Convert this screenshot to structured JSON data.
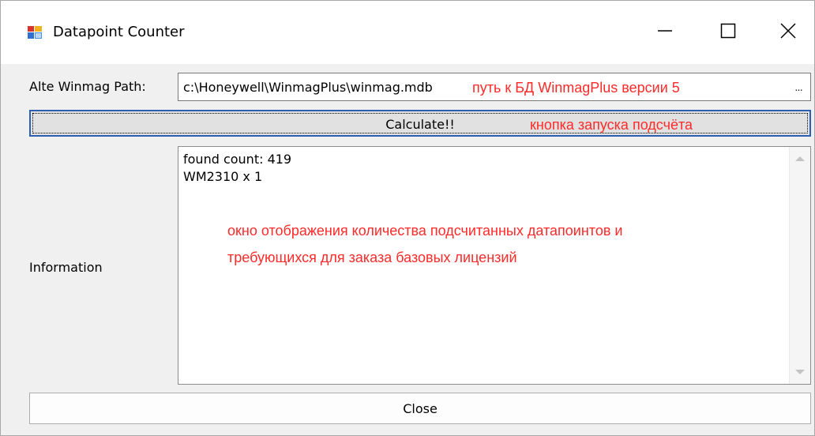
{
  "window": {
    "title": "Datapoint Counter",
    "icon": "app-window-icon",
    "controls": [
      "minimize-icon",
      "maximize-icon",
      "close-icon"
    ]
  },
  "path_field": {
    "label": "Alte Winmag Path:",
    "value": "c:\\Honeywell\\WinmagPlus\\winmag.mdb",
    "browse_label": "...",
    "annotation": "путь к БД WinmagPlus версии 5"
  },
  "calculate": {
    "label": "Calculate!!",
    "annotation": "кнопка запуска подсчёта"
  },
  "information": {
    "label": "Information",
    "lines": [
      "found count: 419",
      "WM2310 x 1"
    ],
    "annotation_line1": "окно отображения количества подсчитанных датапоинтов и",
    "annotation_line2": "требующихся  для заказа базовых лицензий"
  },
  "close_button": {
    "label": "Close"
  },
  "colors": {
    "annotation": "#ff2a2a",
    "focus_border": "#2f5fb3",
    "window_bg": "#f0f0f0"
  }
}
